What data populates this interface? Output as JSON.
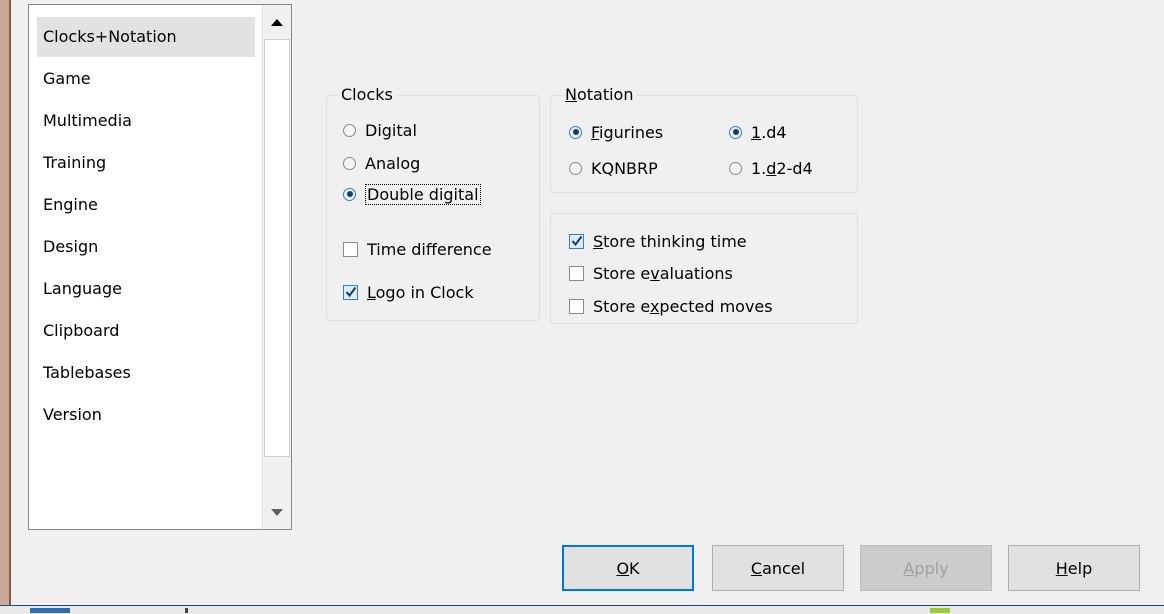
{
  "sidebar": {
    "items": [
      {
        "label": "Clocks+Notation",
        "selected": true
      },
      {
        "label": "Game"
      },
      {
        "label": "Multimedia"
      },
      {
        "label": "Training"
      },
      {
        "label": "Engine"
      },
      {
        "label": "Design"
      },
      {
        "label": "Language"
      },
      {
        "label": "Clipboard"
      },
      {
        "label": "Tablebases"
      },
      {
        "label": "Version"
      }
    ]
  },
  "clocks": {
    "title": "Clocks",
    "options": [
      {
        "label": "Digital",
        "checked": false
      },
      {
        "label": "Analog",
        "checked": false
      },
      {
        "label": "Double digital",
        "checked": true
      }
    ],
    "time_difference": {
      "label": "Time difference",
      "checked": false
    },
    "logo": {
      "accel": "L",
      "rest": "ogo in Clock",
      "checked": true
    }
  },
  "notation": {
    "title_accel": "N",
    "title_rest": "otation",
    "figurines": {
      "accel": "F",
      "rest": "igurines",
      "checked": true
    },
    "kqnbrp": {
      "label": "KQNBRP",
      "checked": false
    },
    "short": {
      "accel": "1",
      "rest": ".d4",
      "checked": true
    },
    "long": {
      "pre": "1.",
      "accel": "d",
      "rest": "2-d4",
      "checked": false
    }
  },
  "store": {
    "thinking": {
      "accel": "S",
      "rest": "tore thinking time",
      "checked": true
    },
    "evaluations": {
      "pre": "Store e",
      "accel": "v",
      "rest": "aluations",
      "checked": false
    },
    "expected": {
      "pre": "Store e",
      "accel": "x",
      "rest": "pected moves",
      "checked": false
    }
  },
  "buttons": {
    "ok": {
      "accel": "O",
      "rest": "K"
    },
    "cancel": {
      "accel": "C",
      "rest": "ancel"
    },
    "apply": {
      "accel": "A",
      "rest": "pply"
    },
    "help": {
      "accel": "H",
      "rest": "elp"
    }
  },
  "colors": {
    "accent": "#0078d7",
    "selected_bg": "#e2e2e2",
    "window_bg": "#f0f0f0"
  }
}
